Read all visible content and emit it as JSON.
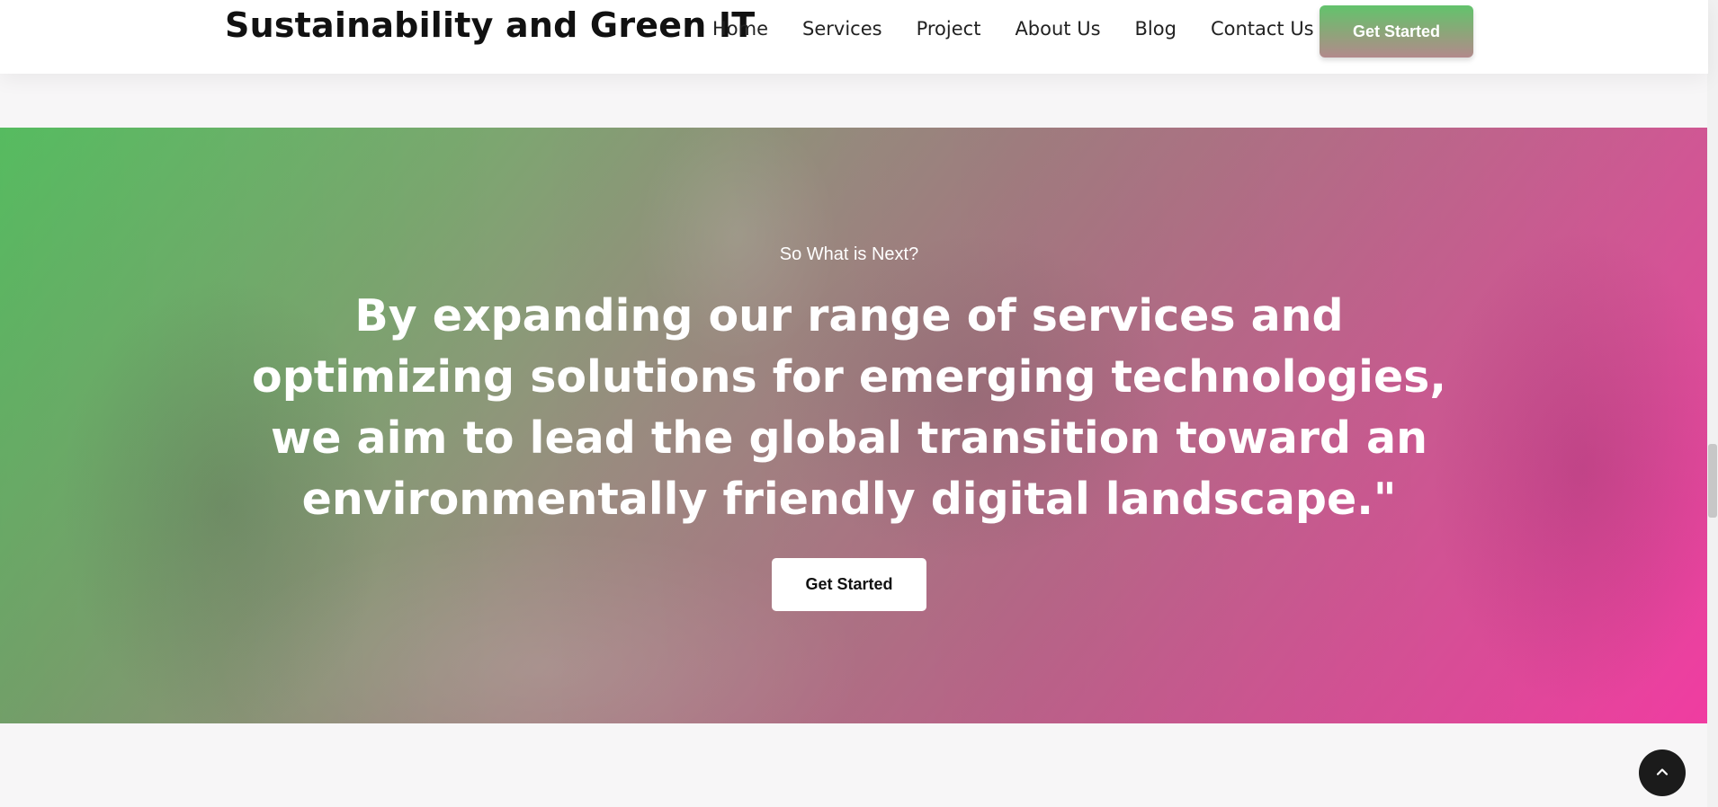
{
  "header": {
    "brand": "Sustainability and Green IT",
    "nav": [
      "Home",
      "Services",
      "Project",
      "About Us",
      "Blog",
      "Contact Us"
    ],
    "cta_label": "Get Started"
  },
  "hero": {
    "eyebrow": "So What is Next?",
    "heading": "By expanding our range of services and optimizing solutions for emerging technologies, we aim to lead the global transition toward an environmentally friendly digital landscape.\"",
    "cta_label": "Get Started"
  },
  "back_to_top": {
    "icon": "chevron-up-icon"
  },
  "colors": {
    "gradient_start": "#5bc766",
    "gradient_end": "#f03ca1",
    "button_dark": "#1b1b1b"
  }
}
